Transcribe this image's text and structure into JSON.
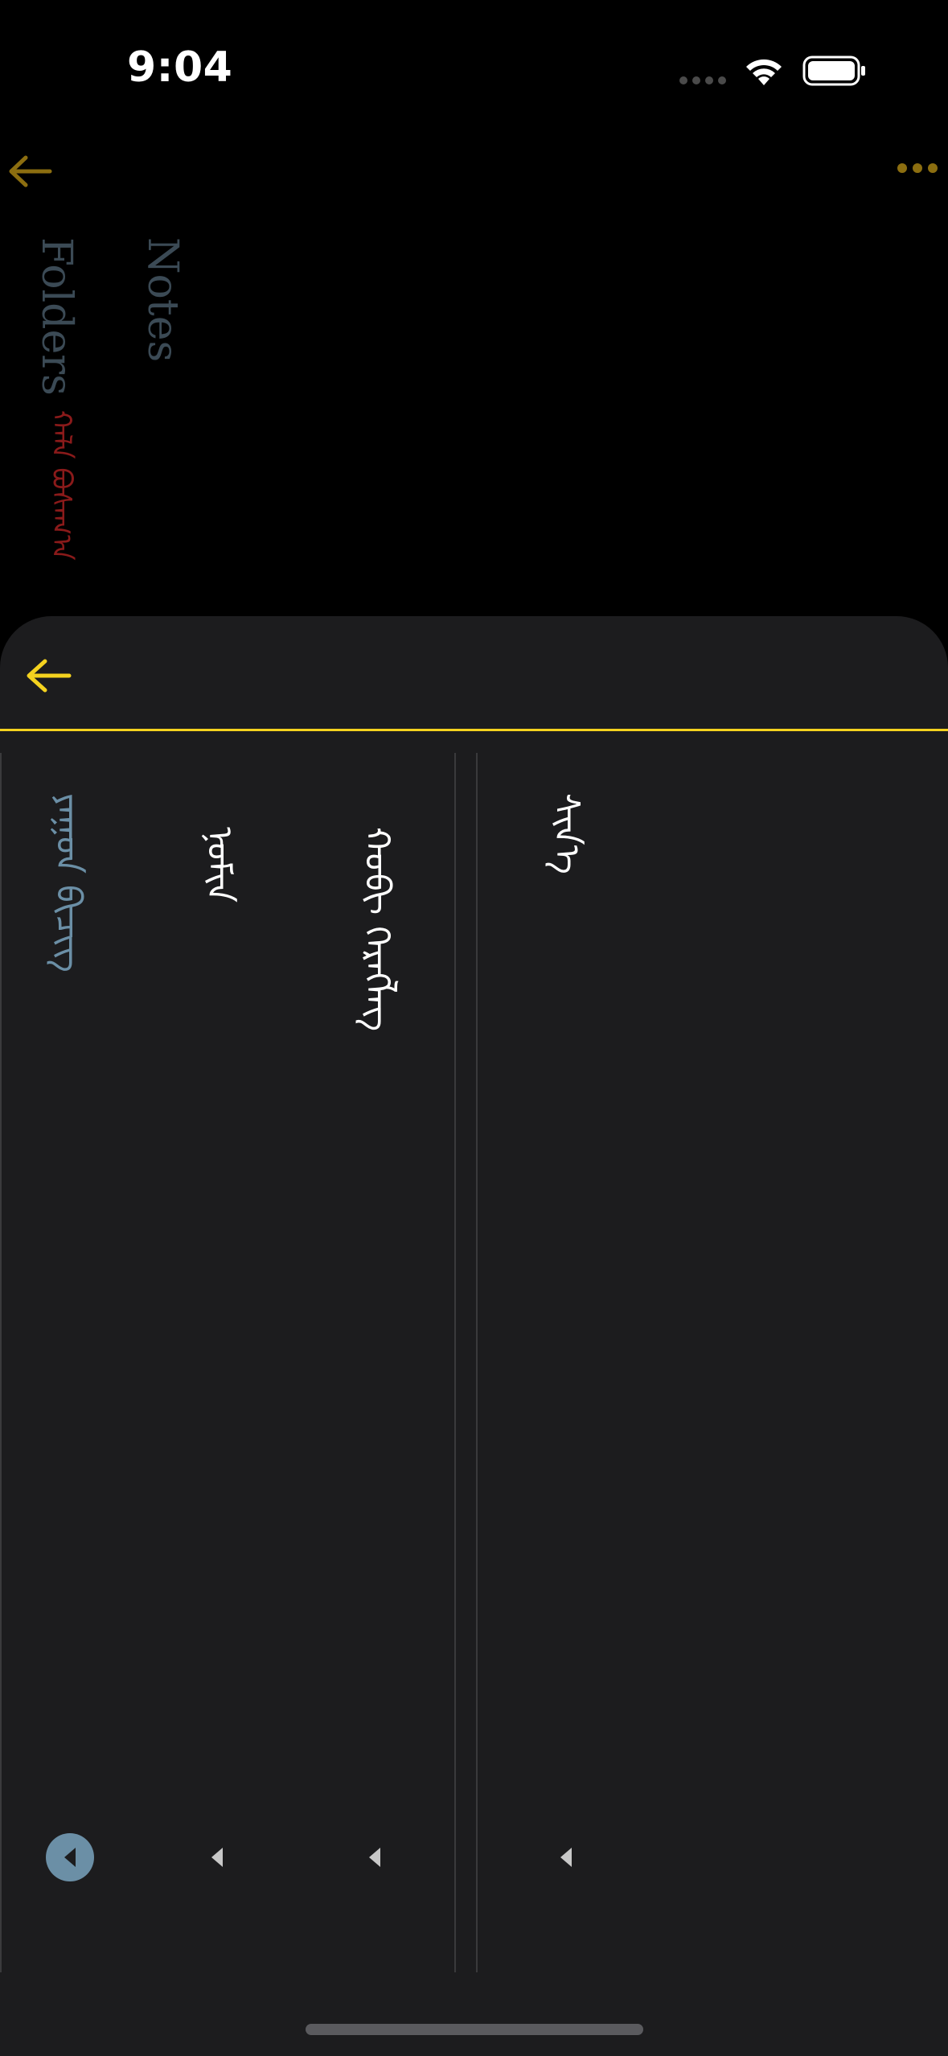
{
  "status_bar": {
    "time": "9:04"
  },
  "background_page": {
    "folders_label": "Folders",
    "notes_label": "Notes",
    "mongolian_label": "ᠬᠠᠯᠠ ᠪᠣᠰᠠᠭ᠎ᠠ",
    "accent_color": "#8c6e10"
  },
  "sheet": {
    "accent_color": "#f4d21f",
    "items": [
      {
        "label": "ᠶᠠᠭᠤᠨ ᠪᠢᠴᠢᠭ",
        "selected": true
      },
      {
        "label": "ᠨᠣᠮᠢᠨ",
        "selected": false
      },
      {
        "label": "ᠬᠤᠪᠢ ᠬᠡᠷᠡᠭᠯᠡᠭ",
        "selected": false
      },
      {
        "label": "ᠰᠢᠨ᠎ᠡ",
        "selected": false
      }
    ]
  }
}
